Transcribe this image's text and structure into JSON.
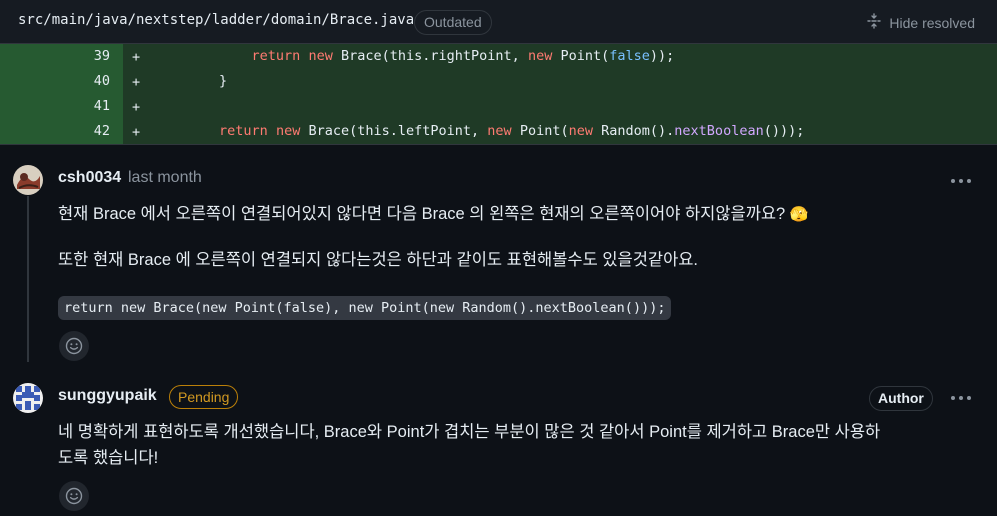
{
  "file": {
    "path": "src/main/java/nextstep/ladder/domain/Brace.java",
    "status_badge": "Outdated",
    "hide_resolved_label": "Hide resolved"
  },
  "diff": {
    "lines": [
      {
        "num": "39",
        "marker": "+"
      },
      {
        "num": "40",
        "marker": "+"
      },
      {
        "num": "41",
        "marker": "+"
      },
      {
        "num": "42",
        "marker": "+"
      }
    ],
    "code_tokens": {
      "l39": {
        "ret": "return",
        "new1": "new",
        "brace": "Brace(this.rightPoint, ",
        "new2": "new",
        "point": "Point(",
        "lit": "false",
        "end": "));"
      },
      "l40": {
        "text": "}"
      },
      "l42": {
        "ret": "return",
        "new1": "new",
        "brace": "Brace(this.leftPoint, ",
        "new2": "new",
        "point": "Point(",
        "new3": "new",
        "random": "Random().",
        "fn": "nextBoolean",
        "end": "()));"
      }
    }
  },
  "comments": [
    {
      "author": "csh0034",
      "time": "last month",
      "paragraphs": [
        "현재 Brace 에서 오른쪽이 연결되어있지 않다면 다음 Brace 의 왼쪽은 현재의 오른쪽이어야 하지않을까요?",
        "또한 현재 Brace 에 오른쪽이 연결되지 않다는것은 하단과 같이도 표현해볼수도 있을것같아요."
      ],
      "code_snippet": "return new Brace(new Point(false), new Point(new Random().nextBoolean()));",
      "emoji": "🫣"
    },
    {
      "author": "sunggyupaik",
      "status_badge": "Pending",
      "role_badge": "Author",
      "paragraphs": [
        "네 명확하게 표현하도록 개선했습니다, Brace와 Point가 겹치는 부분이 많은 것 같아서 Point를 제거하고 Brace만 사용하",
        "도록 했습니다!"
      ]
    }
  ],
  "icons": {
    "hide_resolved": "unfold-icon",
    "more": "kebab-horizontal-icon",
    "reaction": "smiley-icon"
  },
  "colors": {
    "background": "#0d1117",
    "added_line": "#1f3a26",
    "added_gutter": "#265a31",
    "pending": "#d29922",
    "keyword": "#ff7b72",
    "literal": "#79c0ff",
    "function": "#d2a8ff"
  }
}
